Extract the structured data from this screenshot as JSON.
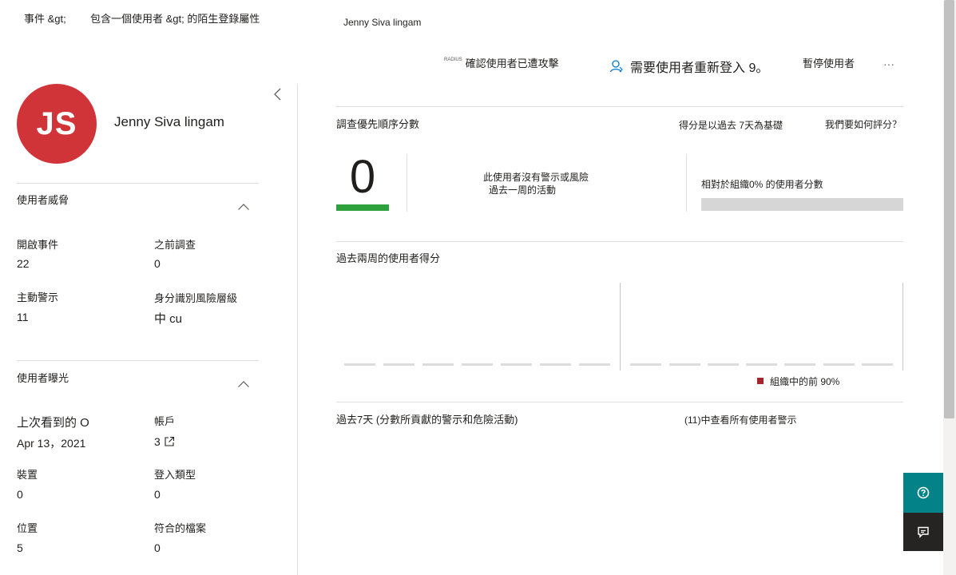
{
  "breadcrumb": {
    "items": [
      "事件 &gt;",
      "包含一個使用者 &gt; 的陌生登錄屬性",
      "Jenny Siva lingam"
    ]
  },
  "actions": {
    "confirm_tag": "RADIUS",
    "confirm_label": "確認使用者已遭攻擊",
    "reauth_label": "需要使用者重新登入 9。",
    "suspend_label": "暫停使用者",
    "more_label": "···"
  },
  "user": {
    "initials": "JS",
    "name": "Jenny Siva lingam",
    "avatar_color": "#d13438"
  },
  "threats": {
    "section_title": "使用者威脅",
    "open_incidents_label": "開啟事件",
    "open_incidents_value": "22",
    "prev_investigations_label": "之前調查",
    "prev_investigations_value": "0",
    "active_alerts_label": "主動警示",
    "active_alerts_value": "11",
    "identity_risk_label": "身分識別風險層級",
    "identity_risk_value": "中 cu"
  },
  "exposure": {
    "section_title": "使用者曝光",
    "last_seen_label": "上次看到的 O",
    "last_seen_value": "Apr 13，2021",
    "accounts_label": "帳戶",
    "accounts_value": "3",
    "devices_label": "裝置",
    "devices_value": "0",
    "login_types_label": "登入類型",
    "login_types_value": "0",
    "locations_label": "位置",
    "locations_value": "5",
    "matched_files_label": "符合的檔案",
    "matched_files_value": "0"
  },
  "priority": {
    "title": "調查優先順序分數",
    "basis_label": "得分是以過去 7天為基礎",
    "how_link": "我們要如何評分？",
    "score": "0",
    "no_alerts_line1": "此使用者沒有警示或風險",
    "no_alerts_line2": "過去一周的活動",
    "relative_label": "相對於組織0% 的使用者分數",
    "score_color": "#2ea03c"
  },
  "two_weeks": {
    "title": "過去兩周的使用者得分",
    "legend_label": "組織中的前 90%",
    "legend_color": "#a4262c"
  },
  "seven_days": {
    "title": "過去7天 (分數所貢獻的警示和危險活動)",
    "view_all_link": "(11)中查看所有使用者警示"
  }
}
